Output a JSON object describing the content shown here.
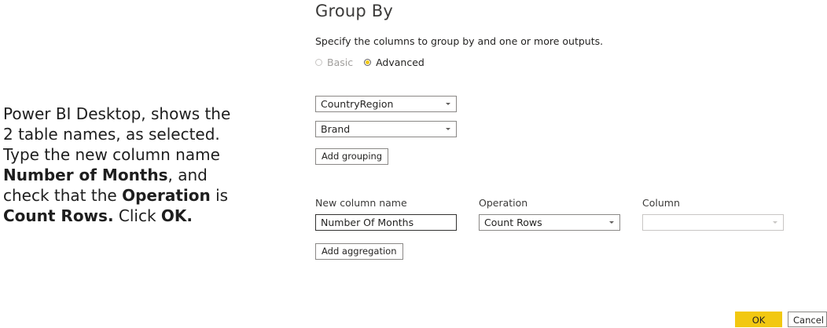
{
  "caption": {
    "part1": "Power BI Desktop, shows the 2 table names, as selected.  Type the new column name ",
    "bold1": "Number of Months",
    "part2": ", and check that the ",
    "bold2": "Operation",
    "part3": " is ",
    "bold3": "Count Rows.",
    "part4": " Click ",
    "bold4": "OK."
  },
  "dialog": {
    "title": "Group By",
    "description": "Specify the columns to group by and one or more outputs.",
    "mode_options": [
      {
        "label": "Basic",
        "selected": false,
        "disabled": true
      },
      {
        "label": "Advanced",
        "selected": true,
        "disabled": false
      }
    ],
    "groupings": [
      "CountryRegion",
      "Brand"
    ],
    "add_grouping_label": "Add grouping",
    "columns": {
      "new_column_name": "New column name",
      "operation": "Operation",
      "column": "Column"
    },
    "aggregation": {
      "new_column_value": "Number Of Months",
      "operation_value": "Count Rows",
      "column_value": ""
    },
    "add_aggregation_label": "Add aggregation",
    "ok_label": "OK",
    "cancel_label": "Cancel"
  },
  "colors": {
    "accent": "#f2c811",
    "border": "#8a8886"
  }
}
